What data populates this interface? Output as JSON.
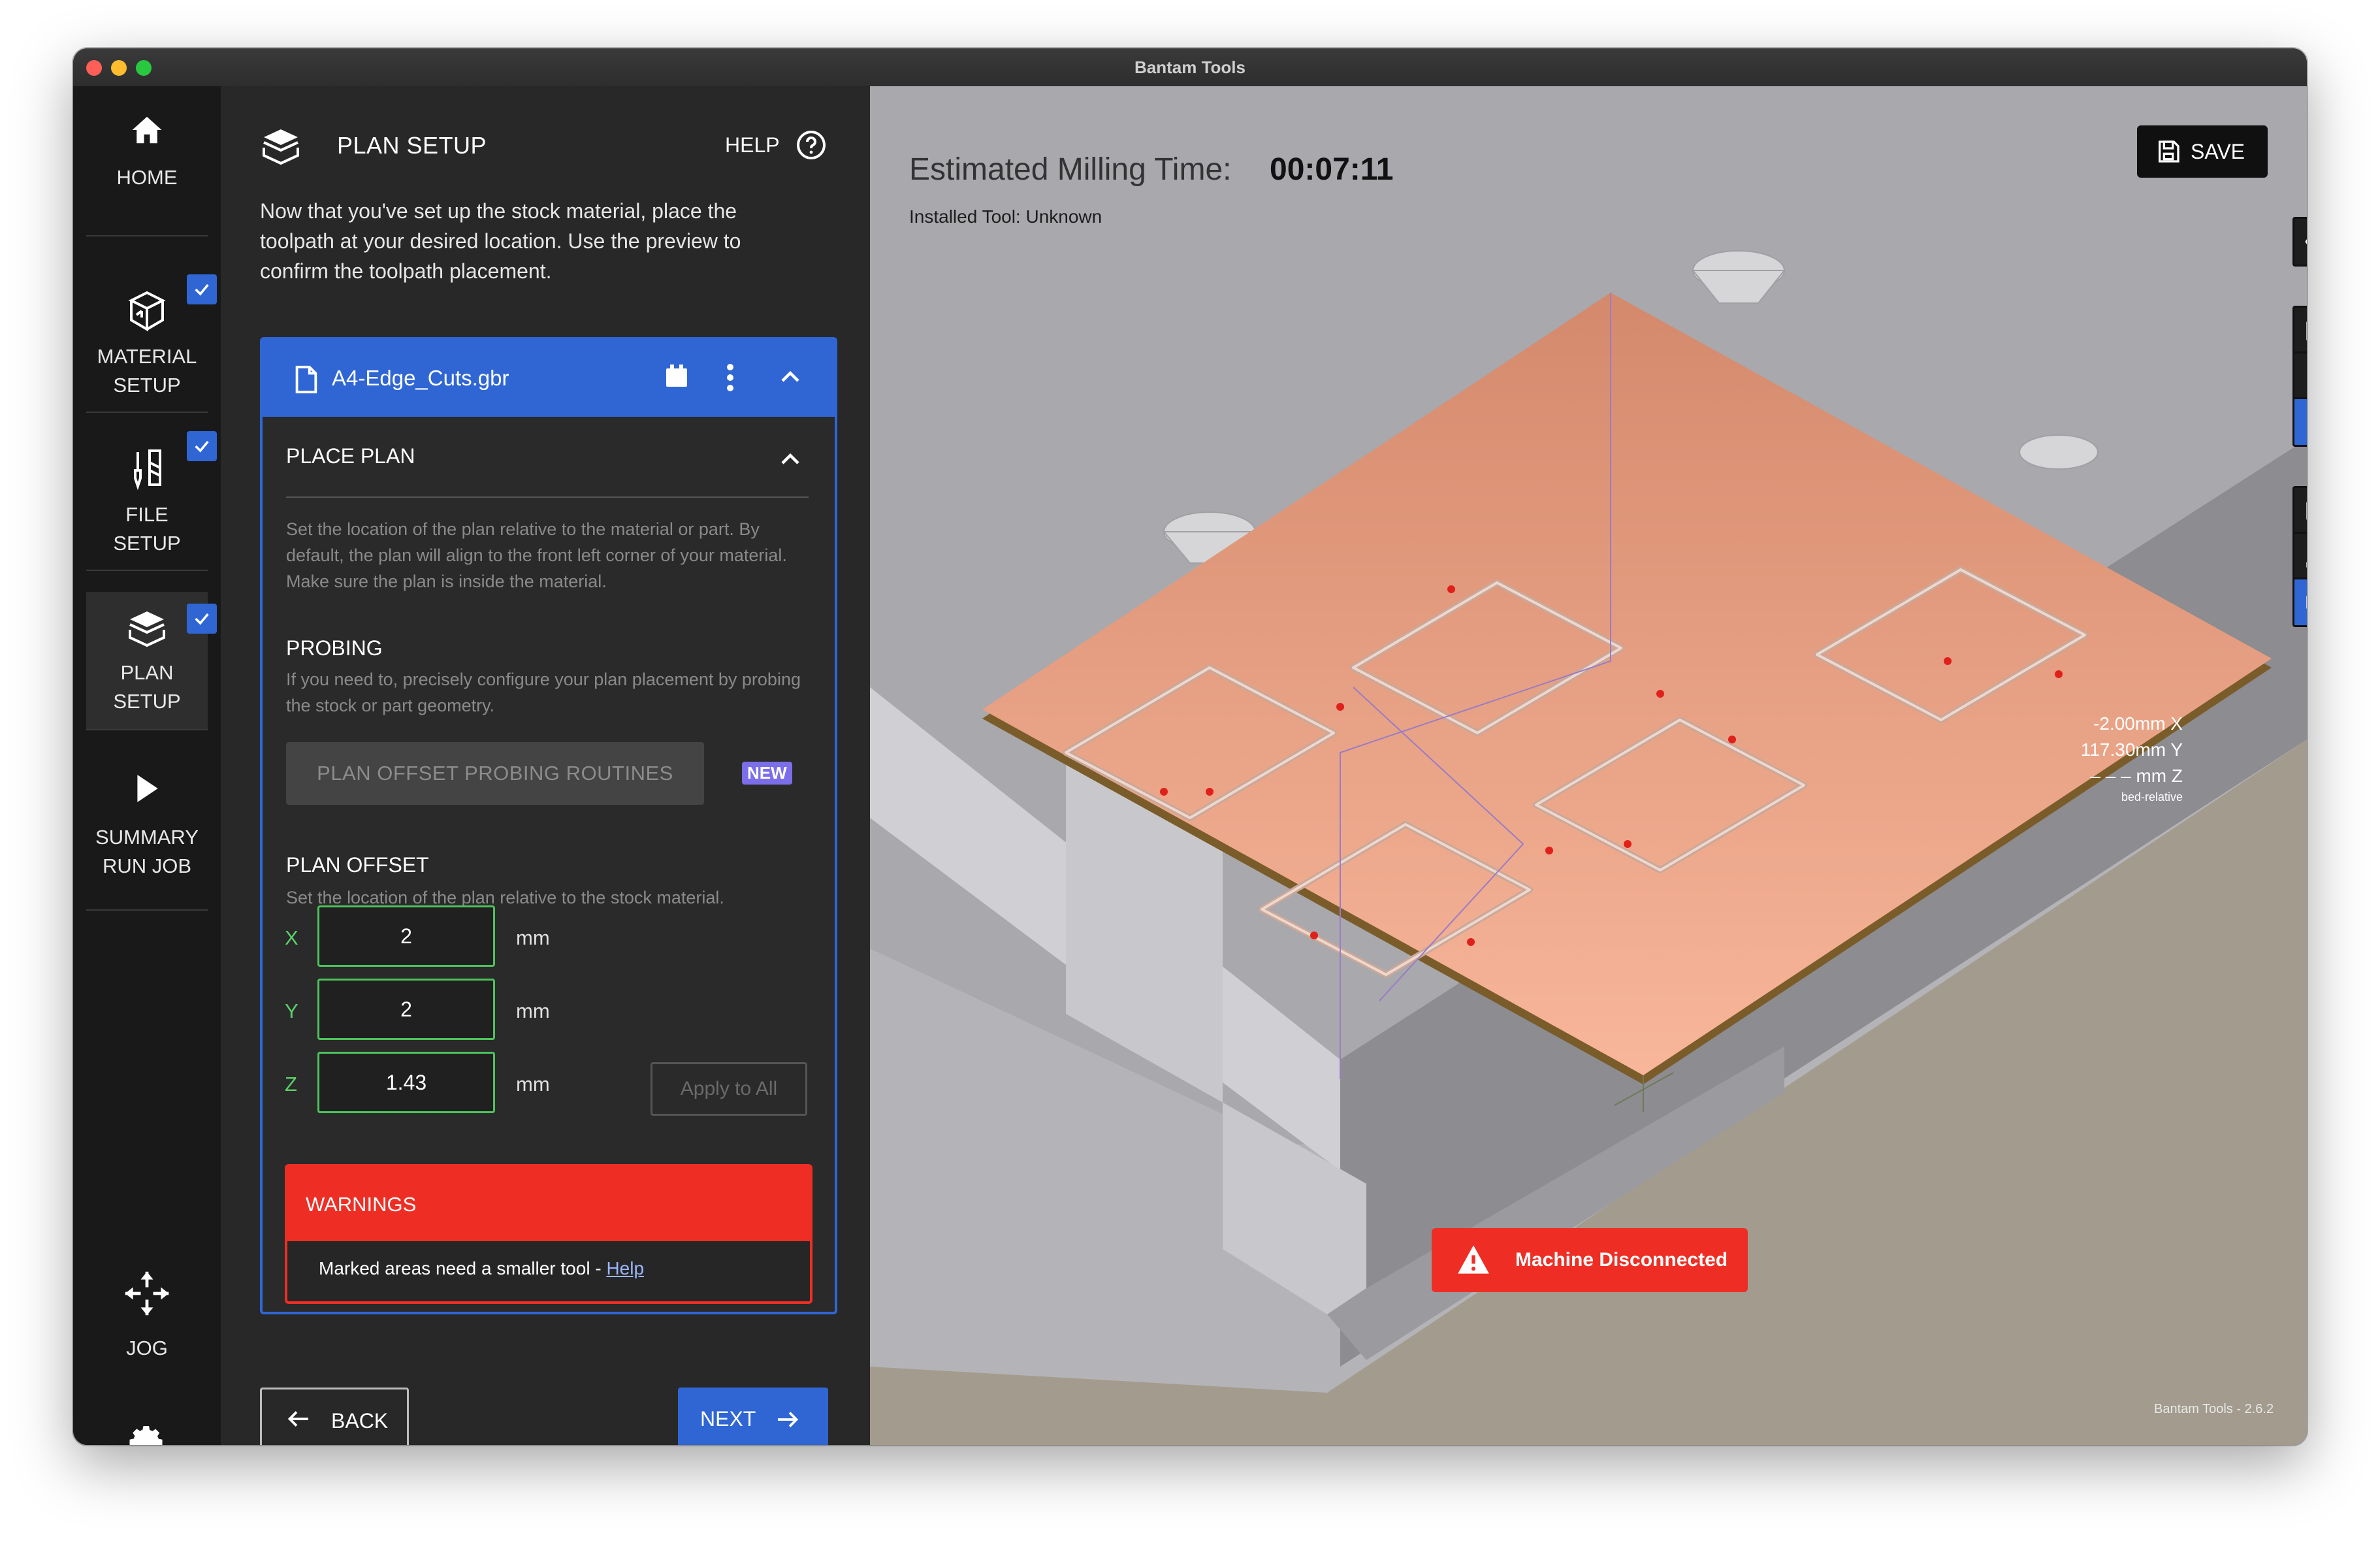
{
  "window": {
    "title": "Bantam Tools"
  },
  "nav": {
    "home": "HOME",
    "material_setup": [
      "MATERIAL",
      "SETUP"
    ],
    "file_setup": [
      "FILE",
      "SETUP"
    ],
    "plan_setup": [
      "PLAN",
      "SETUP"
    ],
    "summary": [
      "SUMMARY",
      "RUN JOB"
    ],
    "jog": "JOG"
  },
  "panel": {
    "title": "PLAN SETUP",
    "help": "HELP",
    "intro": "Now that you've set up the stock material, place the toolpath at your desired location. Use the preview to confirm the toolpath placement.",
    "file_name": "A4-Edge_Cuts.gbr",
    "place_plan": {
      "title": "PLACE PLAN",
      "description": "Set the location of the plan relative to the material or part. By default, the plan will align to the front left corner of your material. Make sure the plan is inside the material."
    },
    "probing": {
      "title": "PROBING",
      "description": "If you need to, precisely configure your plan placement by probing the stock or part geometry.",
      "button": "PLAN OFFSET PROBING ROUTINES",
      "badge": "NEW"
    },
    "plan_offset": {
      "title": "PLAN OFFSET",
      "description": "Set the location of the plan relative to the stock material.",
      "x_label": "X",
      "x_value": "2",
      "y_label": "Y",
      "y_value": "2",
      "z_label": "Z",
      "z_value": "1.43",
      "unit": "mm",
      "apply": "Apply to All"
    },
    "warnings": {
      "title": "WARNINGS",
      "text": "Marked areas need a smaller tool - ",
      "link": "Help"
    },
    "back": "BACK",
    "next": "NEXT"
  },
  "viewport": {
    "estimated_label": "Estimated Milling Time:",
    "estimated_value": "00:07:11",
    "installed_tool": "Installed Tool: Unknown",
    "save": "SAVE",
    "coords": {
      "x": "-2.00mm X",
      "y": "117.30mm Y",
      "z": "– – – mm Z",
      "frame": "bed-relative"
    },
    "disconnected": "Machine Disconnected",
    "version": "Bantam Tools - 2.6.2"
  },
  "colors": {
    "accent": "#2f66d4",
    "warning": "#ee2e24",
    "field_border": "#4cc45b",
    "copper": "#f2a27f"
  }
}
